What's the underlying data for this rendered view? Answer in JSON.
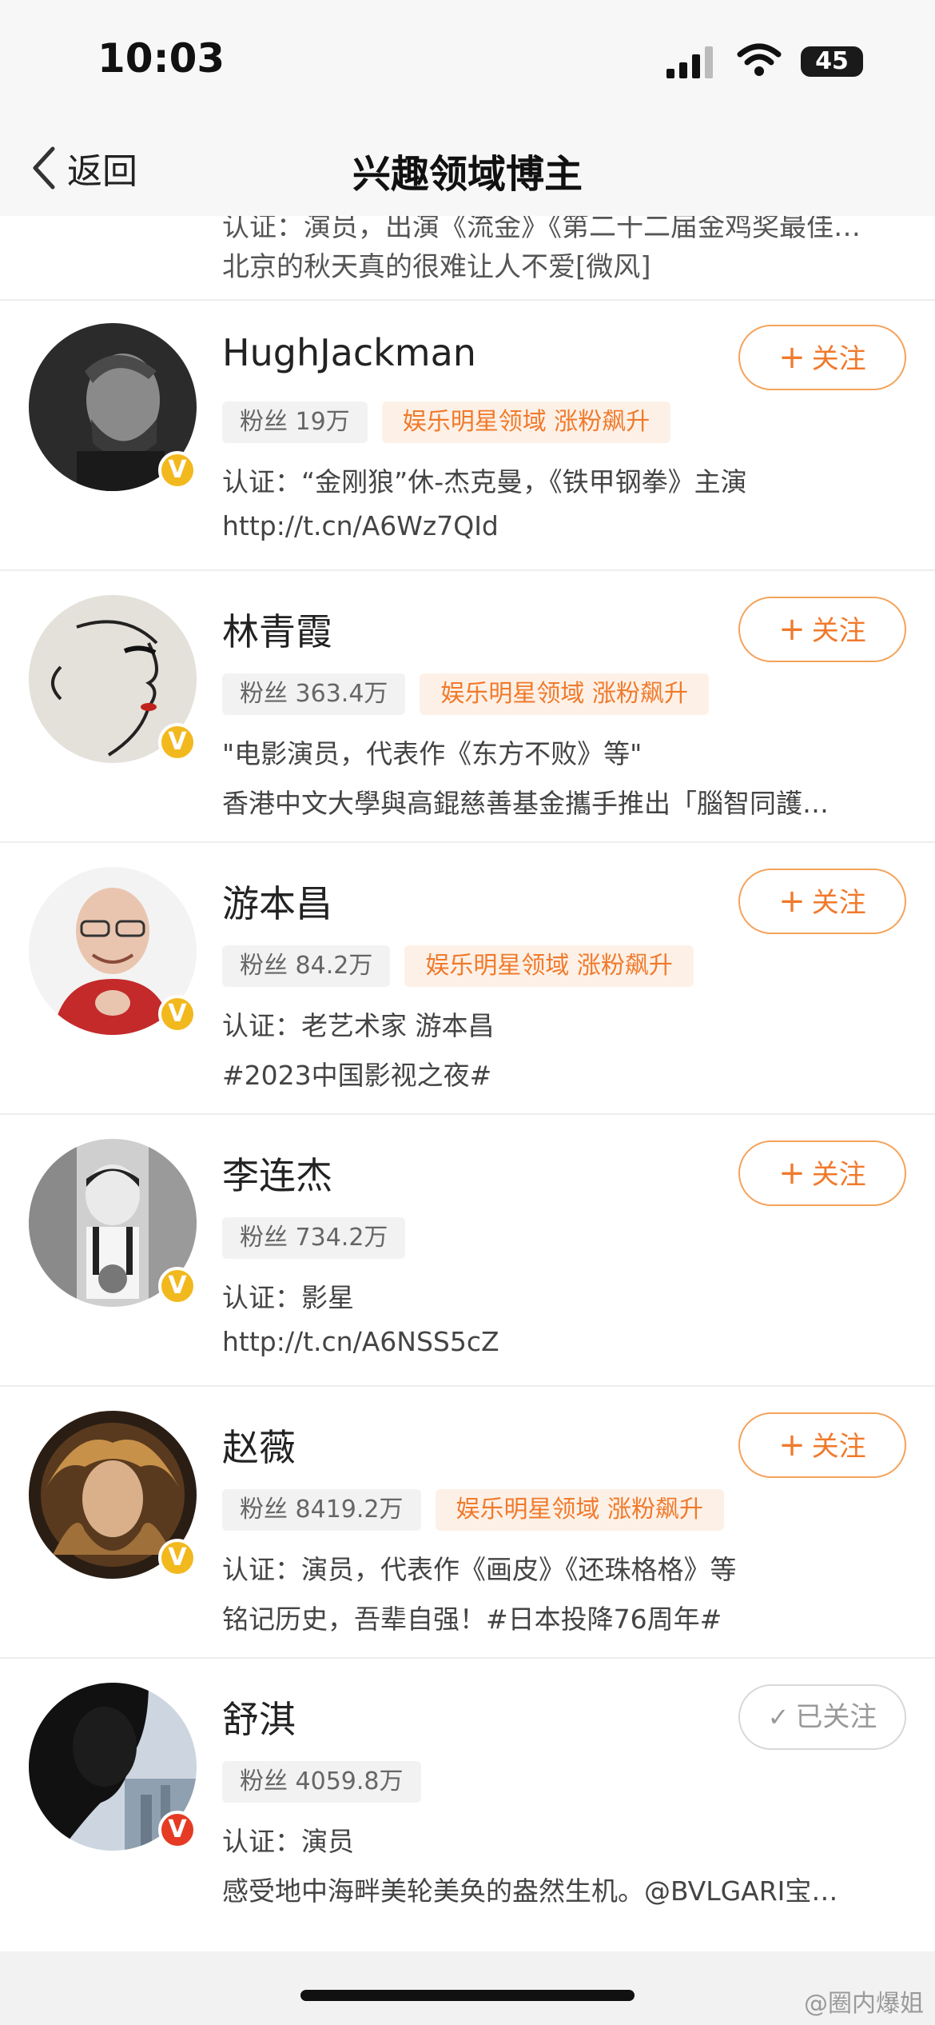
{
  "status": {
    "time": "10:03",
    "battery": "45"
  },
  "nav": {
    "back_label": "返回",
    "title": "兴趣领域博主"
  },
  "partial": {
    "line1": "认证：演员，出演《流金》《第二十二届金鸡奖最佳…",
    "line2": "北京的秋天真的很难让人不爱[微风]"
  },
  "users": [
    {
      "name": "HughJackman",
      "fans": "粉丝 19万",
      "domain": "娱乐明星领域 涨粉飙升",
      "desc1": "认证：“金刚狼”休-杰克曼，《铁甲钢拳》主演",
      "desc2": "http://t.cn/A6Wz7QId",
      "follow": "关注",
      "badge": "V",
      "badge_color": "gold"
    },
    {
      "name": "林青霞",
      "fans": "粉丝 363.4万",
      "domain": "娱乐明星领域 涨粉飙升",
      "desc1": "\"电影演员，代表作《东方不败》等\"",
      "desc2": "香港中文大學與高錕慈善基金攜手推出「腦智同護…",
      "follow": "关注",
      "badge": "V",
      "badge_color": "gold"
    },
    {
      "name": "游本昌",
      "fans": "粉丝 84.2万",
      "domain": "娱乐明星领域 涨粉飙升",
      "desc1": "认证：老艺术家 游本昌",
      "desc2": "#2023中国影视之夜#",
      "follow": "关注",
      "badge": "V",
      "badge_color": "gold"
    },
    {
      "name": "李连杰",
      "fans": "粉丝 734.2万",
      "domain": "",
      "desc1": "认证：影星",
      "desc2": "http://t.cn/A6NSS5cZ",
      "follow": "关注",
      "badge": "V",
      "badge_color": "gold"
    },
    {
      "name": "赵薇",
      "fans": "粉丝 8419.2万",
      "domain": "娱乐明星领域 涨粉飙升",
      "desc1": "认证：演员，代表作《画皮》《还珠格格》等",
      "desc2": "铭记历史，吾辈自强！#日本投降76周年#",
      "follow": "关注",
      "badge": "V",
      "badge_color": "gold"
    },
    {
      "name": "舒淇",
      "fans": "粉丝 4059.8万",
      "domain": "",
      "desc1": "认证：演员",
      "desc2": "感受地中海畔美轮美奂的盎然生机。@BVLGARI宝…",
      "follow": "已关注",
      "badge": "V",
      "badge_color": "red"
    }
  ],
  "watermark": "@圈内爆姐"
}
